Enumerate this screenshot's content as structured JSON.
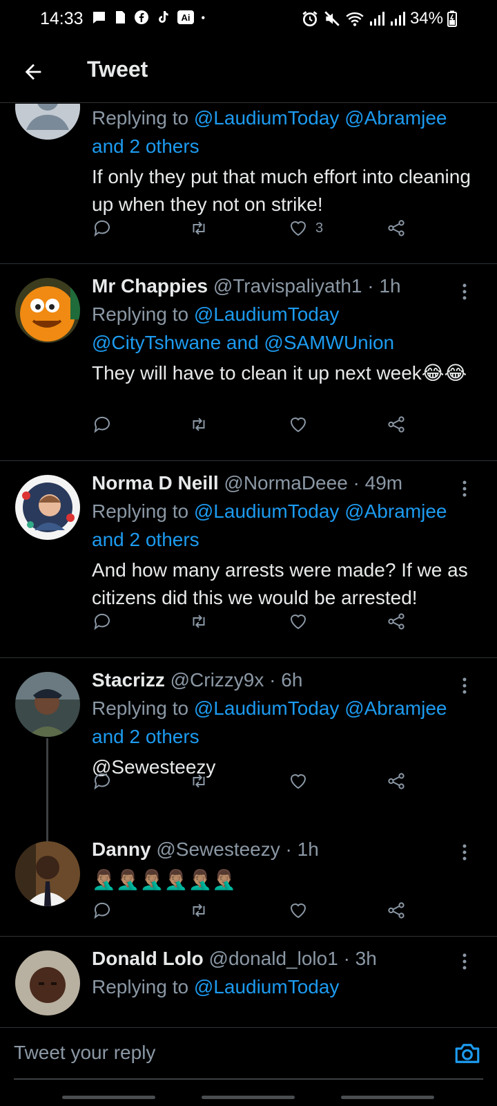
{
  "status_bar": {
    "time": "14:33",
    "battery": "34%",
    "notif_icons": [
      "chat-icon",
      "sim-icon",
      "facebook-icon",
      "tiktok-icon",
      "ai-icon",
      "dot-icon"
    ],
    "ai_badge": "Ai"
  },
  "header": {
    "title": "Tweet"
  },
  "tweets": [
    {
      "reply_prefix": "Replying to ",
      "mentions": [
        "@LaudiumToday @Abramjee",
        "and 2 others"
      ],
      "text": "If only they put that much effort into cleaning up when they not on strike!",
      "likes": "3"
    },
    {
      "name": "Mr Chappies",
      "handle": "@Travispaliyath1",
      "time": "· 1h",
      "reply_prefix": "Replying to ",
      "mentions": [
        "@LaudiumToday",
        "@CityTshwane and @SAMWUnion"
      ],
      "text": "They will have to clean it up next week😂😂",
      "likes": ""
    },
    {
      "name": "Norma D Neill",
      "handle": "@NormaDeee",
      "time": "· 49m",
      "reply_prefix": "Replying to ",
      "mentions": [
        "@LaudiumToday @Abramjee",
        "and 2 others"
      ],
      "text": "And how many arrests were made? If we as citizens did this we would be arrested!",
      "likes": ""
    },
    {
      "name": "Stacrizz",
      "handle": "@Crizzy9x",
      "time": "· 6h",
      "reply_prefix": "Replying to ",
      "mentions": [
        "@LaudiumToday @Abramjee",
        "and 2 others"
      ],
      "text": "@Sewesteezy",
      "likes": ""
    },
    {
      "name": "Danny",
      "handle": "@Sewesteezy",
      "time": "· 1h",
      "text": "🤦🏽‍♂️🤦🏽‍♂️🤦🏽‍♂️🤦🏽‍♂️🤦🏽‍♂️🤦🏽‍♂️",
      "likes": ""
    },
    {
      "name": "Donald Lolo",
      "handle": "@donald_lolo1",
      "time": "· 3h",
      "reply_prefix": "Replying to ",
      "mentions": [
        "@LaudiumToday"
      ]
    }
  ],
  "compose": {
    "placeholder": "Tweet your reply"
  },
  "colors": {
    "accent": "#1d9bf0",
    "muted": "#8b98a5",
    "background": "#000000",
    "divider": "#2f3336"
  }
}
